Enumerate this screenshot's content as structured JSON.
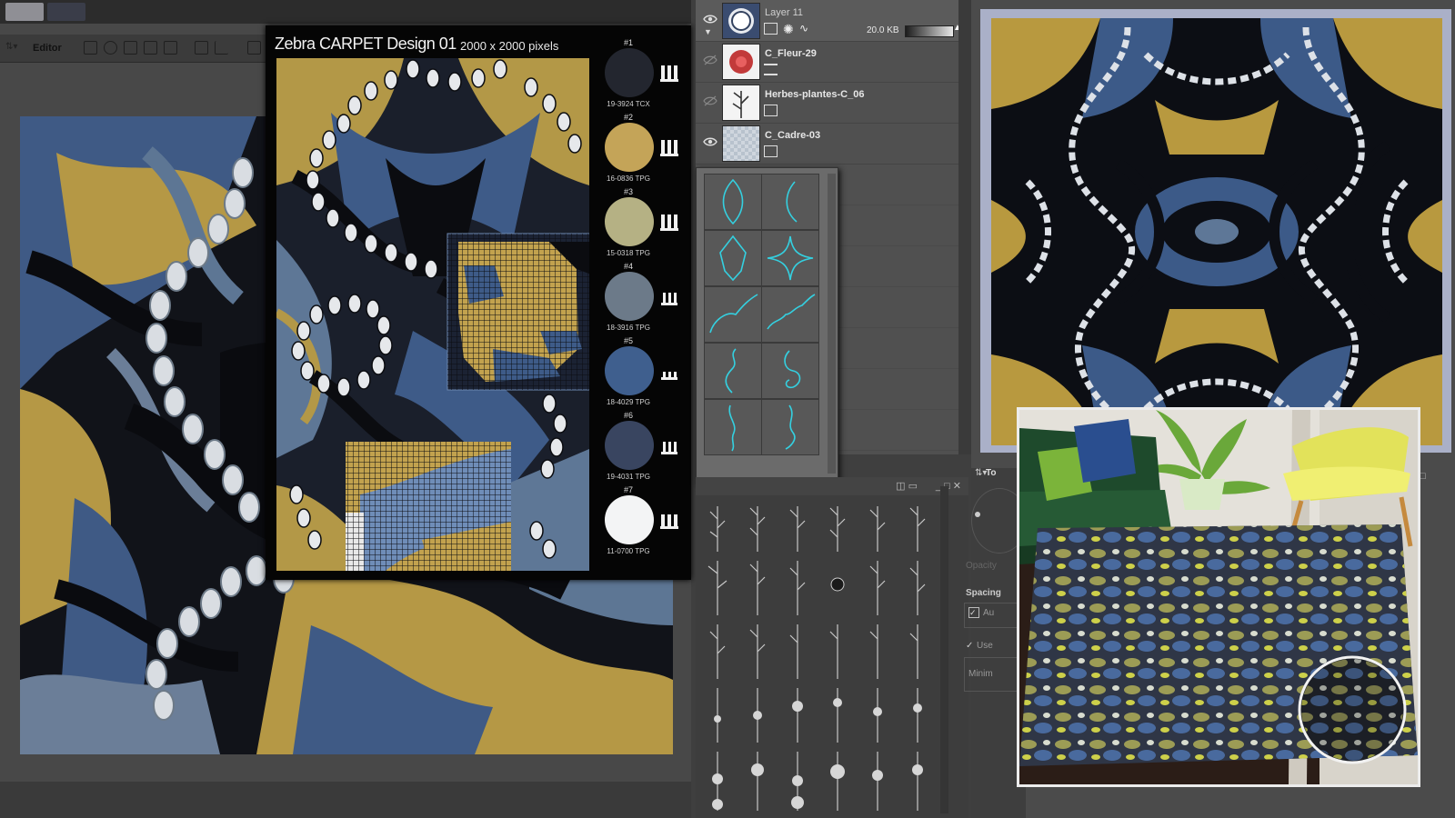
{
  "app": {
    "editor_label": "Editor"
  },
  "design": {
    "title": "Zebra CARPET Design 01",
    "size": "2000 x 2000 pixels"
  },
  "palette": [
    {
      "num": "#1",
      "code": "19-3924 TCX",
      "color": "#23262f"
    },
    {
      "num": "#2",
      "code": "16-0836 TPG",
      "color": "#c4a458"
    },
    {
      "num": "#3",
      "code": "15-0318 TPG",
      "color": "#b5b184"
    },
    {
      "num": "#4",
      "code": "18-3916 TPG",
      "color": "#6c7a89"
    },
    {
      "num": "#5",
      "code": "18-4029 TPG",
      "color": "#3f5f8e"
    },
    {
      "num": "#6",
      "code": "19-4031 TPG",
      "color": "#394560"
    },
    {
      "num": "#7",
      "code": "11-0700 TPG",
      "color": "#f3f4f5"
    }
  ],
  "layers": [
    {
      "name": "Layer 11",
      "size": "20.0 KB",
      "visible": true
    },
    {
      "name": "C_Fleur-29",
      "visible": false
    },
    {
      "name": "Herbes-plantes-C_06",
      "visible": false
    },
    {
      "name": "C_Cadre-03",
      "visible": true
    }
  ],
  "tool_panel": {
    "labels": [
      "Opacity",
      "Spacing",
      "Au",
      "Use",
      "Minim"
    ],
    "title_fragment": "To"
  },
  "colors": {
    "navy": "#1c2233",
    "gold": "#c2a24e",
    "steel": "#5d7694",
    "blue": "#3d5a87",
    "cream": "#dfe2e6"
  }
}
